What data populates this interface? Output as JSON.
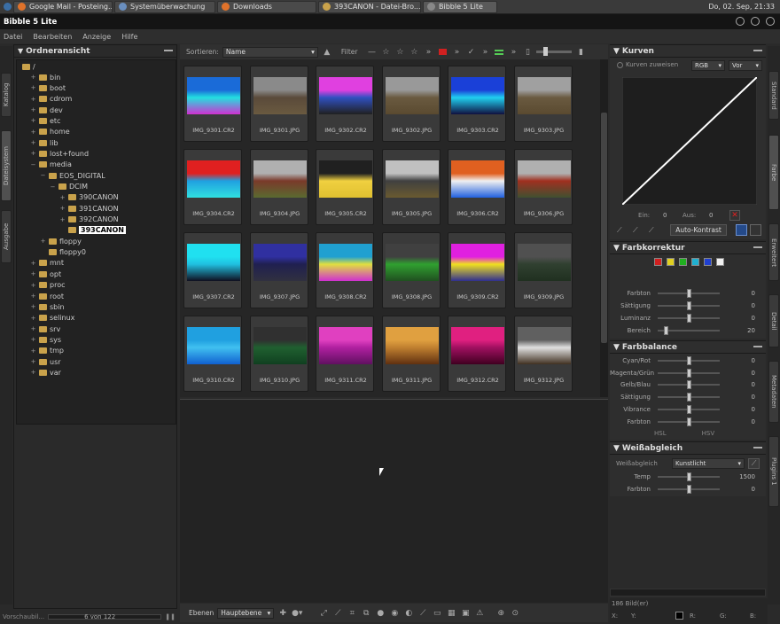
{
  "taskbar": {
    "tasks": [
      {
        "label": "Google Mail - Posteing...",
        "icon": "firefox-icon",
        "color": "#e0722a"
      },
      {
        "label": "Systemüberwachung",
        "icon": "monitor-icon",
        "color": "#6a8fbf"
      },
      {
        "label": "Downloads",
        "icon": "firefox-icon",
        "color": "#e0722a"
      },
      {
        "label": "393CANON - Datei-Bro...",
        "icon": "folder-icon",
        "color": "#c9a24b"
      },
      {
        "label": "Bibble 5 Lite",
        "icon": "bibble-icon",
        "color": "#888888"
      }
    ],
    "clock": "Do, 02. Sep, 21:33"
  },
  "window": {
    "title": "Bibble 5 Lite"
  },
  "menu": [
    "Datei",
    "Bearbeiten",
    "Anzeige",
    "Hilfe"
  ],
  "left_tabs": [
    "Katalog",
    "Dateisystem",
    "Ausgabe"
  ],
  "right_tabs": [
    "Standard",
    "Farbe",
    "Erweitert",
    "Detail",
    "Metadaten",
    "Plugins 1"
  ],
  "folder_panel": {
    "title": "Ordneransicht",
    "root": "/",
    "nodes": [
      {
        "label": "bin",
        "depth": 1,
        "exp": "+"
      },
      {
        "label": "boot",
        "depth": 1,
        "exp": "+"
      },
      {
        "label": "cdrom",
        "depth": 1,
        "exp": "+"
      },
      {
        "label": "dev",
        "depth": 1,
        "exp": "+"
      },
      {
        "label": "etc",
        "depth": 1,
        "exp": "+"
      },
      {
        "label": "home",
        "depth": 1,
        "exp": "+"
      },
      {
        "label": "lib",
        "depth": 1,
        "exp": "+"
      },
      {
        "label": "lost+found",
        "depth": 1,
        "exp": "+"
      },
      {
        "label": "media",
        "depth": 1,
        "exp": "−"
      },
      {
        "label": "EOS_DIGITAL",
        "depth": 2,
        "exp": "−"
      },
      {
        "label": "DCIM",
        "depth": 3,
        "exp": "−"
      },
      {
        "label": "390CANON",
        "depth": 4,
        "exp": "+"
      },
      {
        "label": "391CANON",
        "depth": 4,
        "exp": "+"
      },
      {
        "label": "392CANON",
        "depth": 4,
        "exp": "+"
      },
      {
        "label": "393CANON",
        "depth": 4,
        "exp": "",
        "selected": true
      },
      {
        "label": "floppy",
        "depth": 2,
        "exp": "+"
      },
      {
        "label": "floppy0",
        "depth": 2,
        "exp": ""
      },
      {
        "label": "mnt",
        "depth": 1,
        "exp": "+"
      },
      {
        "label": "opt",
        "depth": 1,
        "exp": "+"
      },
      {
        "label": "proc",
        "depth": 1,
        "exp": "+"
      },
      {
        "label": "root",
        "depth": 1,
        "exp": "+"
      },
      {
        "label": "sbin",
        "depth": 1,
        "exp": "+"
      },
      {
        "label": "selinux",
        "depth": 1,
        "exp": "+"
      },
      {
        "label": "srv",
        "depth": 1,
        "exp": "+"
      },
      {
        "label": "sys",
        "depth": 1,
        "exp": "+"
      },
      {
        "label": "tmp",
        "depth": 1,
        "exp": "+"
      },
      {
        "label": "usr",
        "depth": 1,
        "exp": "+"
      },
      {
        "label": "var",
        "depth": 1,
        "exp": "+"
      }
    ]
  },
  "left_status": {
    "label": "Vorschaubil...",
    "count": "6 von 122"
  },
  "toolbar": {
    "sort_label": "Sortieren:",
    "sort_value": "Name",
    "filter_label": "Filter"
  },
  "thumbnails": [
    {
      "name": "IMG_9301.CR2",
      "colors": [
        "#1a6bd8",
        "#22e0e0",
        "#d030d0"
      ]
    },
    {
      "name": "IMG_9301.JPG",
      "colors": [
        "#8a8a8a",
        "#5a4a3a",
        "#6a5a40"
      ]
    },
    {
      "name": "IMG_9302.CR2",
      "colors": [
        "#e040e0",
        "#3050c0",
        "#202020"
      ]
    },
    {
      "name": "IMG_9302.JPG",
      "colors": [
        "#999999",
        "#6a5a40",
        "#5a4a30"
      ]
    },
    {
      "name": "IMG_9303.CR2",
      "colors": [
        "#1a40d8",
        "#20d0f0",
        "#101040"
      ]
    },
    {
      "name": "IMG_9303.JPG",
      "colors": [
        "#a0a0a0",
        "#6a5a40",
        "#5a4a30"
      ]
    },
    {
      "name": "IMG_9304.CR2",
      "colors": [
        "#e02020",
        "#20a0e0",
        "#30e0e0"
      ]
    },
    {
      "name": "IMG_9304.JPG",
      "colors": [
        "#b0b0b0",
        "#7a3a2a",
        "#5a6a30"
      ]
    },
    {
      "name": "IMG_9305.CR2",
      "colors": [
        "#202020",
        "#f0d040",
        "#e0c030"
      ]
    },
    {
      "name": "IMG_9305.JPG",
      "colors": [
        "#c0c0c0",
        "#404040",
        "#6a5a30"
      ]
    },
    {
      "name": "IMG_9306.CR2",
      "colors": [
        "#e06020",
        "#f0f0f0",
        "#2060e0"
      ]
    },
    {
      "name": "IMG_9306.JPG",
      "colors": [
        "#b0b0b0",
        "#a03020",
        "#405030"
      ]
    },
    {
      "name": "IMG_9307.CR2",
      "colors": [
        "#20e0f0",
        "#20c0e0",
        "#101020"
      ]
    },
    {
      "name": "IMG_9307.JPG",
      "colors": [
        "#3030a0",
        "#202050",
        "#303040"
      ]
    },
    {
      "name": "IMG_9308.CR2",
      "colors": [
        "#20a0d0",
        "#e0e040",
        "#d030d0"
      ]
    },
    {
      "name": "IMG_9308.JPG",
      "colors": [
        "#404040",
        "#30a030",
        "#205020"
      ]
    },
    {
      "name": "IMG_9309.CR2",
      "colors": [
        "#e020e0",
        "#f0e020",
        "#303090"
      ]
    },
    {
      "name": "IMG_9309.JPG",
      "colors": [
        "#505050",
        "#304030",
        "#203020"
      ]
    },
    {
      "name": "IMG_9310.CR2",
      "colors": [
        "#20a0e0",
        "#40c0f0",
        "#1060d0"
      ]
    },
    {
      "name": "IMG_9310.JPG",
      "colors": [
        "#303030",
        "#206030",
        "#104020"
      ]
    },
    {
      "name": "IMG_9311.CR2",
      "colors": [
        "#e040c0",
        "#b020a0",
        "#601060"
      ]
    },
    {
      "name": "IMG_9311.JPG",
      "colors": [
        "#e0a040",
        "#c08030",
        "#603010"
      ]
    },
    {
      "name": "IMG_9312.CR2",
      "colors": [
        "#e02080",
        "#a01060",
        "#400020"
      ]
    },
    {
      "name": "IMG_9312.JPG",
      "colors": [
        "#606060",
        "#e0e0e0",
        "#403020"
      ]
    }
  ],
  "bottom_toolbar": {
    "layers_label": "Ebenen",
    "layer_value": "Hauptebene"
  },
  "kurven": {
    "title": "Kurven",
    "assign": "Kurven zuweisen",
    "channel": "RGB",
    "mode": "Vor",
    "in_label": "Ein:",
    "in_val": "0",
    "out_label": "Aus:",
    "out_val": "0",
    "auto": "Auto-Kontrast"
  },
  "farbkorrektur": {
    "title": "Farbkorrektur",
    "swatches": [
      "#d02020",
      "#e0d020",
      "#20b020",
      "#20b0d0",
      "#2040d0",
      "#f0f0f0"
    ],
    "rows": [
      {
        "label": "Farbton",
        "value": "0",
        "pos": 0.5
      },
      {
        "label": "Sättigung",
        "value": "0",
        "pos": 0.5
      },
      {
        "label": "Luminanz",
        "value": "0",
        "pos": 0.5
      },
      {
        "label": "Bereich",
        "value": "20",
        "pos": 0.1
      }
    ]
  },
  "farbbalance": {
    "title": "Farbbalance",
    "rows": [
      {
        "label": "Cyan/Rot",
        "value": "0",
        "pos": 0.5
      },
      {
        "label": "Magenta/Grün",
        "value": "0",
        "pos": 0.5
      },
      {
        "label": "Gelb/Blau",
        "value": "0",
        "pos": 0.5
      },
      {
        "label": "Sättigung",
        "value": "0",
        "pos": 0.5
      },
      {
        "label": "Vibrance",
        "value": "0",
        "pos": 0.5
      },
      {
        "label": "Farbton",
        "value": "0",
        "pos": 0.5
      }
    ],
    "hsl": "HSL",
    "hsv": "HSV"
  },
  "weissabgleich": {
    "title": "Weißabgleich",
    "label": "Weißabgleich",
    "value": "Kunstlicht",
    "rows": [
      {
        "label": "Temp",
        "value": "1500",
        "pos": 0.5
      },
      {
        "label": "Farbton",
        "value": "0",
        "pos": 0.5
      }
    ]
  },
  "right_status": {
    "count": "186 Bild(er)",
    "x": "X:",
    "y": "Y:",
    "r": "R:",
    "g": "G:",
    "b": "B:"
  }
}
